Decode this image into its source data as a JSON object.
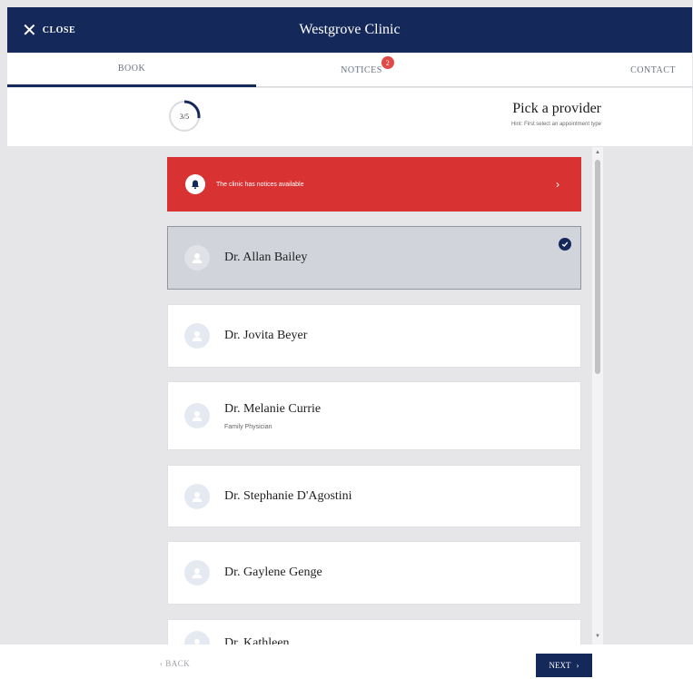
{
  "header": {
    "close_label": "CLOSE",
    "title": "Westgrove Clinic"
  },
  "tabs": [
    {
      "label": "BOOK",
      "active": true
    },
    {
      "label": "NOTICES",
      "badge": "2"
    },
    {
      "label": "CONTACT"
    }
  ],
  "step": {
    "indicator": "3/5",
    "progress": 0.6,
    "title": "Pick a provider",
    "hint": "Hint: First select an appointment type"
  },
  "notice": {
    "text": "The clinic has notices available",
    "chevron": "›"
  },
  "providers": [
    {
      "name": "Dr. Allan Bailey",
      "subtitle": "",
      "selected": true
    },
    {
      "name": "Dr. Jovita Beyer",
      "subtitle": "",
      "selected": false
    },
    {
      "name": "Dr. Melanie Currie",
      "subtitle": "Family Physician",
      "selected": false
    },
    {
      "name": "Dr. Stephanie D'Agostini",
      "subtitle": "",
      "selected": false
    },
    {
      "name": "Dr. Gaylene Genge",
      "subtitle": "",
      "selected": false
    },
    {
      "name": "Dr. Kathleen ...",
      "subtitle": "",
      "selected": false
    }
  ],
  "footer": {
    "back_label": "‹ BACK",
    "next_label": "NEXT",
    "next_chevron": "›"
  },
  "colors": {
    "brand": "#14285a",
    "alert": "#d93233",
    "badge": "#e24a48",
    "selected_bg": "#d1d4db"
  }
}
